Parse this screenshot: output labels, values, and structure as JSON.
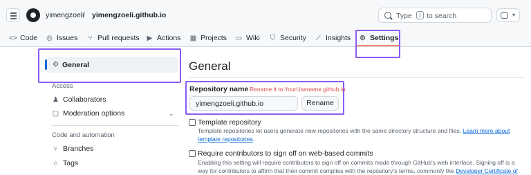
{
  "header": {
    "owner": "yimengzoeli",
    "separator": "/",
    "repo": "yimengzoeli.github.io",
    "search": {
      "prefix": "Type",
      "key": "/",
      "suffix": "to search"
    }
  },
  "tabs": [
    {
      "label": "Code",
      "icon": "code-icon"
    },
    {
      "label": "Issues",
      "icon": "issue-icon"
    },
    {
      "label": "Pull requests",
      "icon": "pull-request-icon"
    },
    {
      "label": "Actions",
      "icon": "play-icon"
    },
    {
      "label": "Projects",
      "icon": "table-icon"
    },
    {
      "label": "Wiki",
      "icon": "book-icon"
    },
    {
      "label": "Security",
      "icon": "shield-icon"
    },
    {
      "label": "Insights",
      "icon": "graph-icon"
    },
    {
      "label": "Settings",
      "icon": "gear-icon",
      "selected": true
    }
  ],
  "sidebar": {
    "general": "General",
    "access_heading": "Access",
    "collaborators": "Collaborators",
    "moderation": "Moderation options",
    "code_heading": "Code and automation",
    "branches": "Branches",
    "tags": "Tags"
  },
  "main": {
    "title": "General",
    "repo_name_label": "Repository name",
    "annotation": "Rename it to YourUsename.github.io",
    "repo_name_value": "yimengzoeli.github.io",
    "rename_button": "Rename",
    "template": {
      "title": "Template repository",
      "desc": "Template repositories let users generate new repositories with the same directory structure and files.",
      "link": "Learn more about template repositories",
      "end": "."
    },
    "signoff": {
      "title": "Require contributors to sign off on web-based commits",
      "desc": "Enabling this setting will require contributors to sign off on commits made through GitHub's web interface. Signing off is a way for contributors to affirm that their commit complies with the repository's terms, commonly the",
      "link": "Developer Certificate of Origin (DCO)",
      "end": "."
    }
  },
  "colors": {
    "highlight": "#8a5cf5",
    "annotation": "#e5484d",
    "accent": "#0969da",
    "tab_underline": "#fd8c73"
  }
}
